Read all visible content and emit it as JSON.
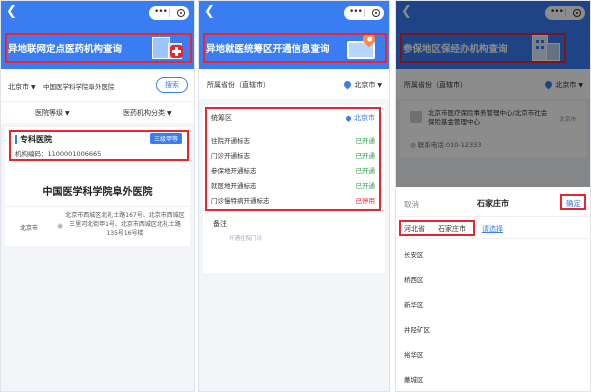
{
  "panel1": {
    "banner_title": "异地联网定点医药机构查询",
    "city": "北京市",
    "search_value": "中国医学科学院阜外医院",
    "search_button": "搜索",
    "filters": [
      "医院等级",
      "医药机构分类"
    ],
    "card": {
      "type": "专科医院",
      "level": "三级甲等",
      "code": "机构编码：1100001006665",
      "name": "中国医学科学院阜外医院",
      "addr_city": "北京市",
      "address": "北京市西城区北礼士路167号、北京市西城区三里河北街甲1号、北京市西城区北礼士路135号16号楼"
    }
  },
  "panel2": {
    "banner_title": "异地就医统筹区开通信息查询",
    "prov_label": "所属省份（直辖市）",
    "prov_value": "北京市",
    "region_label": "统筹区",
    "region_value": "北京市",
    "rows": [
      {
        "label": "住院开通标志",
        "value": "已开通"
      },
      {
        "label": "门诊开通标志",
        "value": "已开通"
      },
      {
        "label": "参保地开通标志",
        "value": "已开通"
      },
      {
        "label": "就医地开通标志",
        "value": "已开通"
      },
      {
        "label": "门诊慢特病开通标志",
        "value": "已停用"
      }
    ],
    "note_label": "备注",
    "note_text": "开通住院门诊"
  },
  "panel3": {
    "banner_title": "参保地区保经办机构查询",
    "prov_label": "所属省份（直辖市）",
    "prov_value": "北京市",
    "office_name": "北京市医疗保险事务管理中心/北京市社会保险基金管理中心",
    "office_city": "北京市",
    "office_phone": "联系电话:010-12333",
    "cancel": "取消",
    "picker_title": "石家庄市",
    "confirm": "确定",
    "tabs": [
      "河北省",
      "石家庄市",
      "请选择"
    ],
    "districts": [
      "长安区",
      "桥西区",
      "新华区",
      "井陉矿区",
      "裕华区",
      "藁城区"
    ]
  },
  "colors": {
    "primary": "#3a7df3",
    "highlight": "#e8262d",
    "open": "#2a9d4a"
  }
}
